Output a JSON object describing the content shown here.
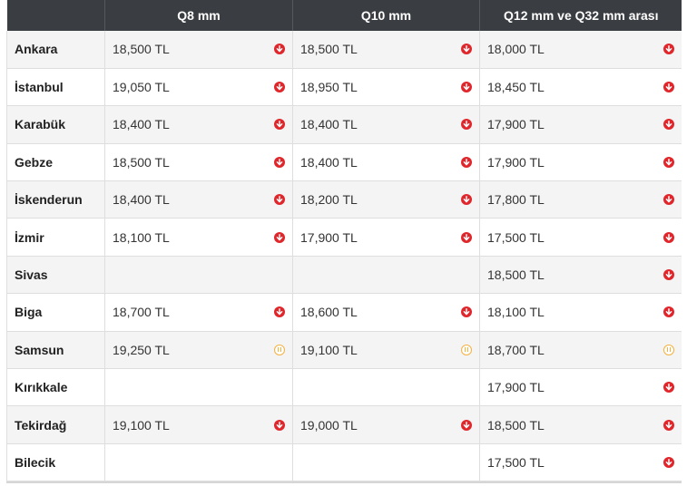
{
  "header": {
    "city": "",
    "q8": "Q8 mm",
    "q10": "Q10 mm",
    "q12": "Q12 mm ve Q32 mm arası"
  },
  "rows": [
    {
      "city": "Ankara",
      "q8": "18,500 TL",
      "q8_trend": "down",
      "q10": "18,500 TL",
      "q10_trend": "down",
      "q12": "18,000 TL",
      "q12_trend": "down"
    },
    {
      "city": "İstanbul",
      "q8": "19,050 TL",
      "q8_trend": "down",
      "q10": "18,950 TL",
      "q10_trend": "down",
      "q12": "18,450 TL",
      "q12_trend": "down"
    },
    {
      "city": "Karabük",
      "q8": "18,400 TL",
      "q8_trend": "down",
      "q10": "18,400 TL",
      "q10_trend": "down",
      "q12": "17,900 TL",
      "q12_trend": "down"
    },
    {
      "city": "Gebze",
      "q8": "18,500 TL",
      "q8_trend": "down",
      "q10": "18,400 TL",
      "q10_trend": "down",
      "q12": "17,900 TL",
      "q12_trend": "down"
    },
    {
      "city": "İskenderun",
      "q8": "18,400 TL",
      "q8_trend": "down",
      "q10": "18,200 TL",
      "q10_trend": "down",
      "q12": "17,800 TL",
      "q12_trend": "down"
    },
    {
      "city": "İzmir",
      "q8": "18,100 TL",
      "q8_trend": "down",
      "q10": "17,900 TL",
      "q10_trend": "down",
      "q12": "17,500 TL",
      "q12_trend": "down"
    },
    {
      "city": "Sivas",
      "q8": "",
      "q8_trend": "",
      "q10": "",
      "q10_trend": "",
      "q12": "18,500 TL",
      "q12_trend": "down"
    },
    {
      "city": "Biga",
      "q8": "18,700 TL",
      "q8_trend": "down",
      "q10": "18,600 TL",
      "q10_trend": "down",
      "q12": "18,100 TL",
      "q12_trend": "down"
    },
    {
      "city": "Samsun",
      "q8": "19,250 TL",
      "q8_trend": "same",
      "q10": "19,100 TL",
      "q10_trend": "same",
      "q12": "18,700 TL",
      "q12_trend": "same"
    },
    {
      "city": "Kırıkkale",
      "q8": "",
      "q8_trend": "",
      "q10": "",
      "q10_trend": "",
      "q12": "17,900 TL",
      "q12_trend": "down"
    },
    {
      "city": "Tekirdağ",
      "q8": "19,100 TL",
      "q8_trend": "down",
      "q10": "19,000 TL",
      "q10_trend": "down",
      "q12": "18,500 TL",
      "q12_trend": "down"
    },
    {
      "city": "Bilecik",
      "q8": "",
      "q8_trend": "",
      "q10": "",
      "q10_trend": "",
      "q12": "17,500 TL",
      "q12_trend": "down"
    }
  ],
  "icons": {
    "down": "arrow-down-circle-icon",
    "same": "pause-circle-icon"
  },
  "colors": {
    "header_bg": "#3a3d42",
    "down": "#e0262b",
    "same": "#f5b13d",
    "row_alt": "#f4f4f4"
  }
}
